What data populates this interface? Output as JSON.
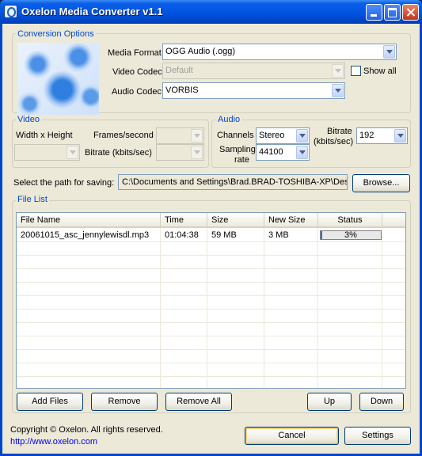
{
  "window": {
    "title": "Oxelon Media Converter v1.1"
  },
  "conversion_options": {
    "legend": "Conversion Options",
    "media_format_label": "Media Format",
    "media_format_value": "OGG Audio (.ogg)",
    "video_codec_label": "Video Codec",
    "video_codec_value": "Default",
    "audio_codec_label": "Audio Codec",
    "audio_codec_value": "VORBIS",
    "show_all_label": "Show all",
    "show_all_checked": false
  },
  "video": {
    "legend": "Video",
    "width_height_label": "Width x Height",
    "frames_label": "Frames/second",
    "bitrate_label": "Bitrate (kbits/sec)"
  },
  "audio": {
    "legend": "Audio",
    "channels_label": "Channels",
    "channels_value": "Stereo",
    "sampling_label_1": "Sampling",
    "sampling_label_2": "rate",
    "sampling_value": "44100",
    "bitrate_label_1": "Bitrate",
    "bitrate_label_2": "(kbits/sec)",
    "bitrate_value": "192"
  },
  "save_path": {
    "label": "Select the path for saving:",
    "value": "C:\\Documents and Settings\\Brad.BRAD-TOSHIBA-XP\\Desk",
    "browse_label": "Browse..."
  },
  "file_list": {
    "legend": "File List",
    "columns": [
      "File Name",
      "Time",
      "Size",
      "New Size",
      "Status"
    ],
    "rows": [
      {
        "file_name": "20061015_asc_jennylewisdl.mp3",
        "time": "01:04:38",
        "size": "59 MB",
        "new_size": "3 MB",
        "status": "3%",
        "progress": 0.03
      }
    ]
  },
  "list_buttons": {
    "add_files": "Add Files",
    "remove": "Remove",
    "remove_all": "Remove All",
    "up": "Up",
    "down": "Down"
  },
  "footer": {
    "copyright": "Copyright © Oxelon. All rights reserved.",
    "link": "http://www.oxelon.com",
    "cancel": "Cancel",
    "settings": "Settings"
  }
}
